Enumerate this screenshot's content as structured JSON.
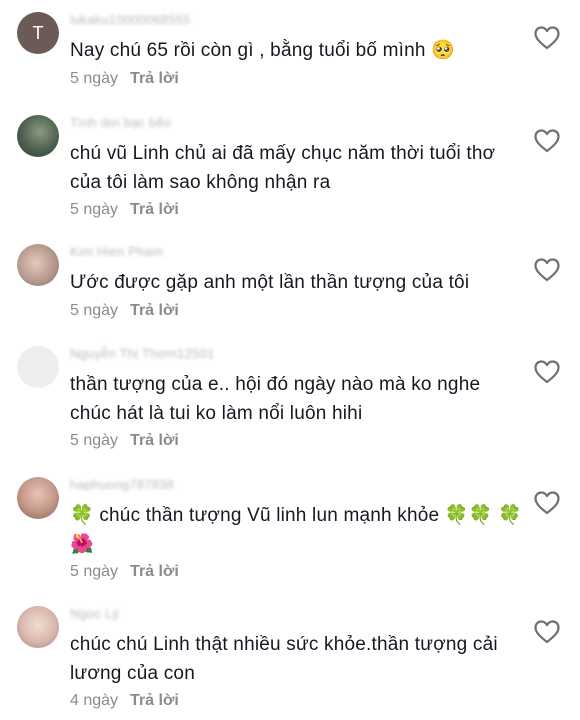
{
  "comments": [
    {
      "username": "lukaku10000068555",
      "text": "Nay chú 65 rồi còn gì , bằng tuổi bố mình 🥺",
      "time": "5 ngày",
      "reply": "Trả lời",
      "avatar": "avatar-letter-t",
      "avatar_letter": "T",
      "avatar_color": "#6b5a55"
    },
    {
      "username": "Tình dơi bạc bẽo",
      "text": "chú vũ Linh chủ ai đã mấy chục năm thời tuổi thơ của tôi làm sao không nhận ra",
      "time": "5 ngày",
      "reply": "Trả lời",
      "avatar": "avatar-photo",
      "avatar_color": "#6a7a6e"
    },
    {
      "username": "Kim Hien Pham",
      "text": "Ước được gặp anh một lần thần tượng của tôi",
      "time": "5 ngày",
      "reply": "Trả lời",
      "avatar": "avatar-photo",
      "avatar_color": "#b79a8e"
    },
    {
      "username": "Nguyễn Thị Thơm12501",
      "text": "thần tượng của e.. hội đó ngày nào mà ko nghe chúc hát là tui ko làm nổi luôn hihi",
      "time": "5 ngày",
      "reply": "Trả lời",
      "avatar": "avatar-blank",
      "avatar_color": "#eeeeee"
    },
    {
      "username": "haphuong787838",
      "text": "🍀 chúc thần tượng Vũ linh lun mạnh khỏe 🍀🍀 🍀🌺",
      "time": "5 ngày",
      "reply": "Trả lời",
      "avatar": "avatar-photo",
      "avatar_color": "#c69a8c"
    },
    {
      "username": "Ngọc Lý",
      "text": "chúc chú Linh thật nhiều sức khỏe.thần tượng cải lương của con",
      "time": "4 ngày",
      "reply": "Trả lời",
      "avatar": "avatar-photo",
      "avatar_color": "#d9b8ad"
    }
  ],
  "icons": {
    "like": "heart-outline-icon"
  },
  "colors": {
    "text": "#161823",
    "username": "#b9bbc1",
    "meta": "#8a8b91",
    "heart": "#6f7076"
  }
}
